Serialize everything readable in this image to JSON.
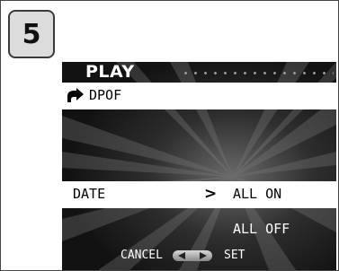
{
  "step": {
    "number": "5"
  },
  "menu": {
    "title": "PLAY",
    "dpof_label": "DPOF",
    "date_label": "DATE",
    "date_arrow": ">",
    "options": [
      {
        "label": "ALL ON",
        "selected": true
      },
      {
        "label": "ALL OFF",
        "selected": false
      }
    ]
  },
  "footer": {
    "cancel_label": "CANCEL",
    "set_label": "SET"
  },
  "colors": {
    "screen_bg": "#151515",
    "highlight_bg": "#ffffff",
    "badge_bg": "#dcdcdc"
  }
}
